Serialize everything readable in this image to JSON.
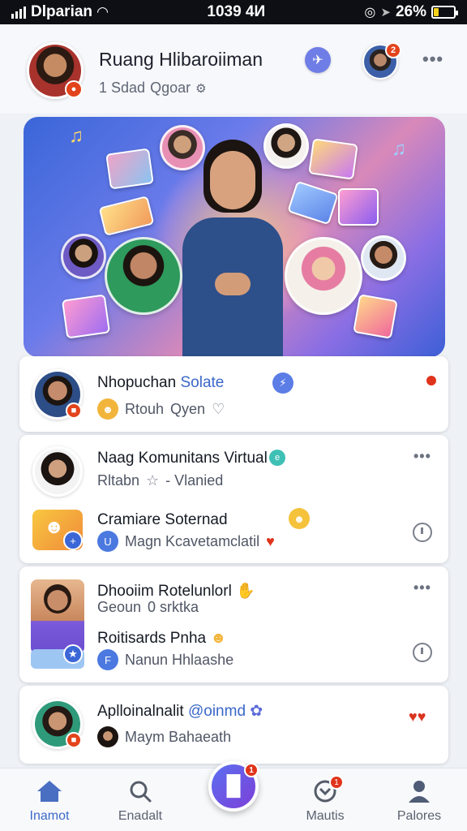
{
  "status_bar": {
    "carrier": "Dlparian",
    "time": "1039 4И",
    "battery": "26%"
  },
  "header": {
    "title": "Ruang Hlibaroiiman",
    "subtitle_count": "1 Sdad",
    "subtitle_text": "Qgoar",
    "notification_count": "2"
  },
  "feed": [
    {
      "title": "Nhopuchan",
      "title_accent": "Solate",
      "subtitle": "Rtouh",
      "subtitle_2": "Qyen"
    },
    {
      "title": "Naag Komunitans Virtual",
      "subtitle": "Rltabn",
      "subtitle_2": "- Vlanied",
      "sub_title": "Cramiare Soternad",
      "sub_subtitle": "Magn Kcavetamclatil"
    },
    {
      "title": "Dhooiim Rotelunlorl",
      "subtitle": "Geoun",
      "subtitle_2": "0 srktka",
      "sub_title": "Roitisards Pnha",
      "sub_subtitle": "Nanun Hhlaashe"
    },
    {
      "title": "Aplloinalnalit",
      "title_accent": "@oinmd",
      "subtitle": "Maym Bahaeath"
    }
  ],
  "bottom_nav": {
    "items": [
      {
        "label": "Inamot"
      },
      {
        "label": "Enadalt"
      },
      {
        "label": "Mautis"
      },
      {
        "label": "Palores"
      }
    ],
    "fab_badge": "1",
    "mautis_badge": "1"
  },
  "colors": {
    "accent": "#3a67c9",
    "badge": "#e0331b",
    "fab": "#6a55e4"
  }
}
